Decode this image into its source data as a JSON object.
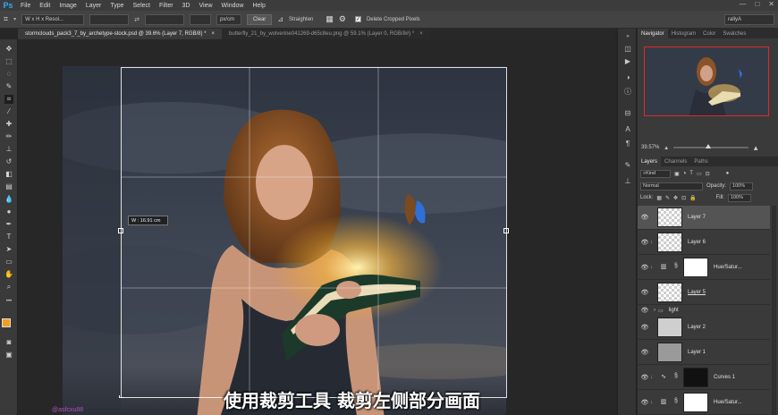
{
  "app": {
    "logo": "Ps"
  },
  "menu": [
    "File",
    "Edit",
    "Image",
    "Layer",
    "Type",
    "Select",
    "Filter",
    "3D",
    "View",
    "Window",
    "Help"
  ],
  "window_controls": [
    "—",
    "□",
    "✕"
  ],
  "options_bar": {
    "ratio_select": "W x H x Resol...",
    "unit_select": "px/cm",
    "clear_label": "Clear",
    "straighten_label": "Straighten",
    "delete_cropped_label": "Delete Cropped Pixels",
    "delete_cropped_checked": true,
    "workspace_select": "rallyA"
  },
  "tabs": [
    {
      "label": "stormclouds_pack3_7_by_archetype-stock.psd @ 39.6% (Layer 7, RGB/8) *",
      "close": "×",
      "active": true
    },
    {
      "label": "butterfly_21_by_wolverine041269-d65c8eu.png @ 59.1% (Layer 0, RGB/8#) *",
      "close": "×",
      "active": false
    }
  ],
  "crop": {
    "tooltip": "W : 16.91 cm"
  },
  "subtitle": "使用裁剪工具 裁剪左侧部分画面",
  "watermark": "@asfcxu88",
  "navigator": {
    "tabs": [
      "Navigator",
      "Histogram",
      "Color",
      "Swatches"
    ],
    "zoom": "39.57%"
  },
  "layers_panel": {
    "tabs": [
      "Layers",
      "Channels",
      "Paths"
    ],
    "kind_label": "Kind",
    "blend_mode": "Normal",
    "opacity_label": "Opacity:",
    "opacity_value": "100%",
    "lock_label": "Lock:",
    "fill_label": "Fill:",
    "fill_value": "100%",
    "layers": [
      {
        "name": "Layer 7",
        "type": "pixel",
        "selected": true,
        "clipped": false
      },
      {
        "name": "Layer 6",
        "type": "pixel",
        "selected": false,
        "clipped": true
      },
      {
        "name": "Hue/Satur...",
        "type": "adjustment",
        "selected": false,
        "clipped": true
      },
      {
        "name": "Layer 5",
        "type": "pixel",
        "selected": false,
        "clipped": false
      },
      {
        "name": "light",
        "type": "group",
        "selected": false,
        "clipped": false
      },
      {
        "name": "Layer 2",
        "type": "pixel",
        "selected": false,
        "clipped": false
      },
      {
        "name": "Layer 1",
        "type": "pixel",
        "selected": false,
        "clipped": false
      },
      {
        "name": "Curves 1",
        "type": "adjustment",
        "selected": false,
        "clipped": true
      },
      {
        "name": "Hue/Satur...",
        "type": "adjustment",
        "selected": false,
        "clipped": true
      }
    ]
  }
}
